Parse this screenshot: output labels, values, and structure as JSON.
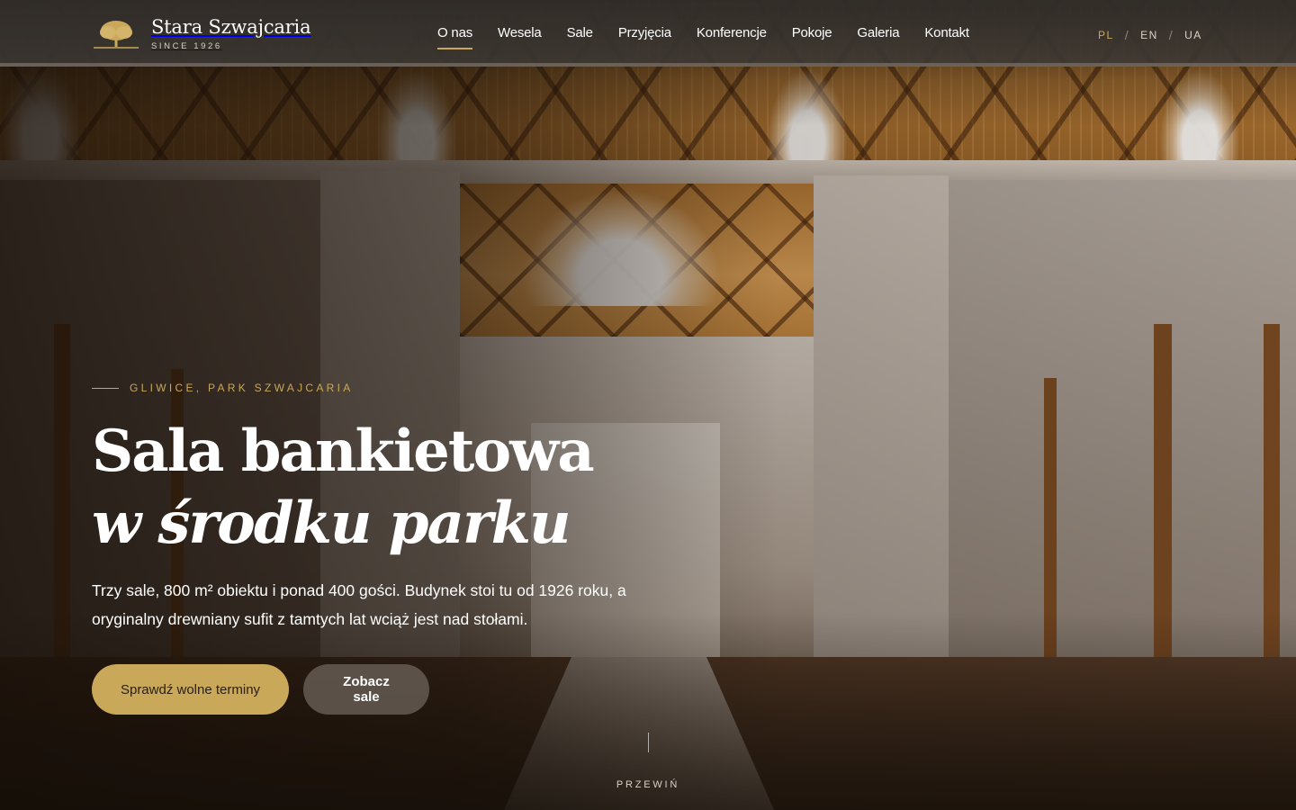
{
  "brand": {
    "name": "Stara Szwajcaria",
    "since": "SINCE 1926",
    "logo_icon": "tree-icon",
    "accent_color": "#c9a85a"
  },
  "nav": {
    "items": [
      {
        "label": "O nas",
        "active": true
      },
      {
        "label": "Wesela"
      },
      {
        "label": "Sale"
      },
      {
        "label": "Przyjęcia"
      },
      {
        "label": "Konferencje"
      },
      {
        "label": "Pokoje"
      },
      {
        "label": "Galeria"
      },
      {
        "label": "Kontakt"
      }
    ]
  },
  "languages": {
    "items": [
      "PL",
      "EN",
      "UA"
    ],
    "current": "PL",
    "separator": "/"
  },
  "hero": {
    "eyebrow": "GLIWICE, PARK SZWAJCARIA",
    "title_line1": "Sala bankietowa",
    "title_line2": "w środku parku",
    "lead": "Trzy sale, 800 m² obiektu i ponad 400 gości. Budynek stoi tu od 1926 roku, a oryginalny drewniany sufit z tamtych lat wciąż jest nad stołami.",
    "primary_cta": "Sprawdź wolne terminy",
    "secondary_cta": "Zobacz sale",
    "scroll_label": "PRZEWIŃ"
  }
}
